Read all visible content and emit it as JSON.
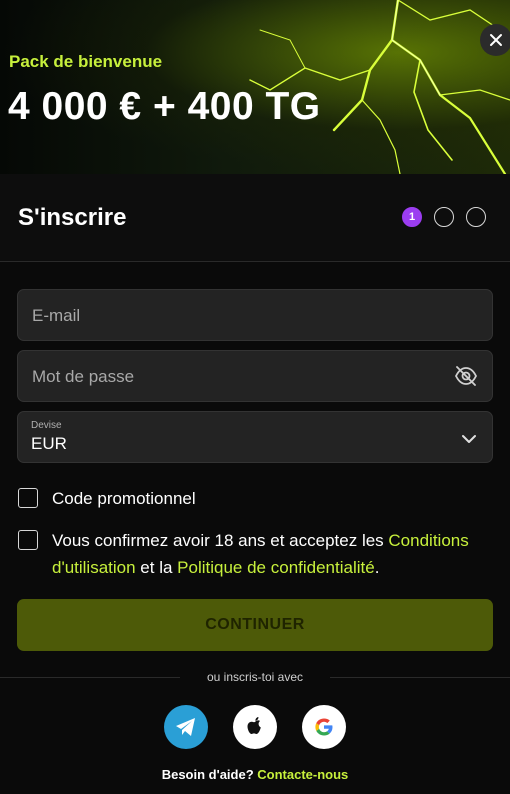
{
  "banner": {
    "subtitle": "Pack de bienvenue",
    "title": "4 000 € + 400 TG"
  },
  "header": {
    "title": "S'inscrire",
    "steps": [
      "1",
      "",
      ""
    ]
  },
  "form": {
    "email_placeholder": "E-mail",
    "password_placeholder": "Mot de passe",
    "currency_label": "Devise",
    "currency_value": "EUR",
    "promo_label": "Code promotionnel",
    "terms_text_1": "Vous confirmez avoir 18 ans et acceptez les ",
    "terms_link_1": "Conditions d'utilisation",
    "terms_text_2": " et la ",
    "terms_link_2": "Politique de confidentialité",
    "terms_text_3": ".",
    "continue_label": "CONTINUER"
  },
  "social": {
    "or_label": "ou inscris-toi avec",
    "providers": [
      "telegram-icon",
      "apple-icon",
      "google-icon"
    ]
  },
  "help": {
    "label": "Besoin d'aide?",
    "link": "Contacte-nous"
  },
  "colors": {
    "accent": "#c7f03c",
    "step_active": "#9b3df0",
    "continue_bg": "#4d5a08",
    "telegram": "#2a9fd6"
  }
}
